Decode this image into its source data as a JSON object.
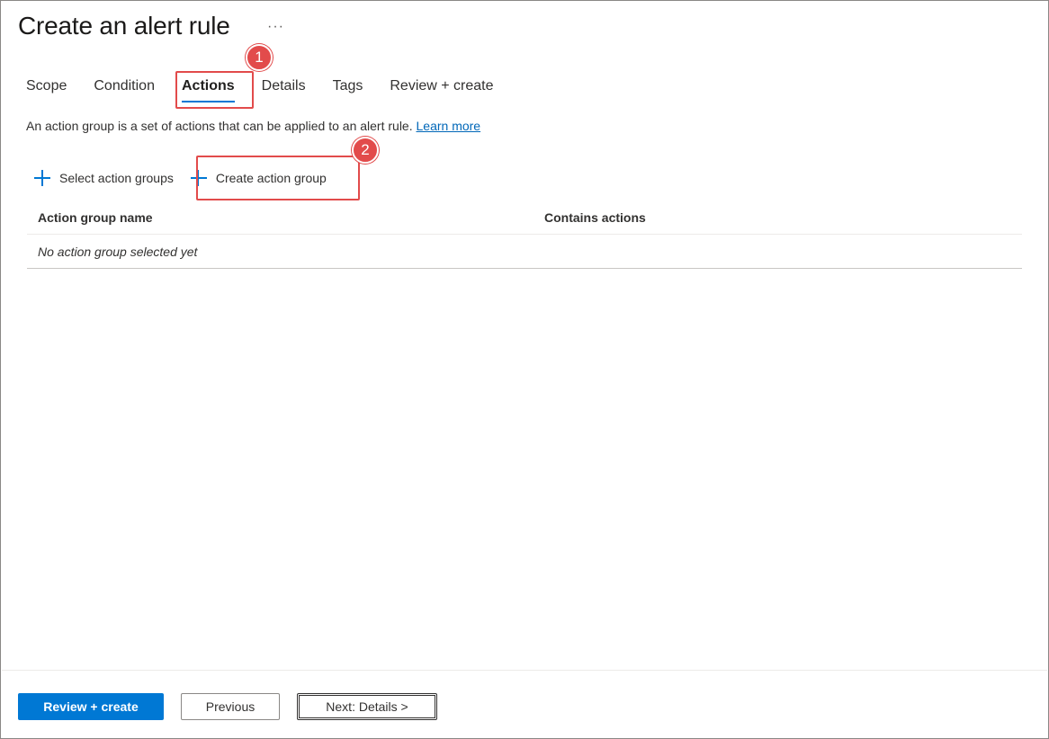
{
  "page": {
    "title": "Create an alert rule",
    "more_label": "···"
  },
  "tabs": [
    {
      "label": "Scope",
      "active": false
    },
    {
      "label": "Condition",
      "active": false
    },
    {
      "label": "Actions",
      "active": true
    },
    {
      "label": "Details",
      "active": false
    },
    {
      "label": "Tags",
      "active": false
    },
    {
      "label": "Review + create",
      "active": false
    }
  ],
  "description": {
    "text": "An action group is a set of actions that can be applied to an alert rule.",
    "link": "Learn more"
  },
  "commands": {
    "select_label": "Select action groups",
    "create_label": "Create action group",
    "icon": "plus-icon"
  },
  "table": {
    "headers": [
      "Action group name",
      "Contains actions"
    ],
    "empty_text": "No action group selected yet"
  },
  "annotations": {
    "badge_1": "1",
    "badge_2": "2",
    "color": "#e24b4b"
  },
  "footer": {
    "review_create": "Review + create",
    "previous": "Previous",
    "next": "Next: Details >"
  },
  "colors": {
    "accent": "#0078d4",
    "link": "#0067b8"
  }
}
